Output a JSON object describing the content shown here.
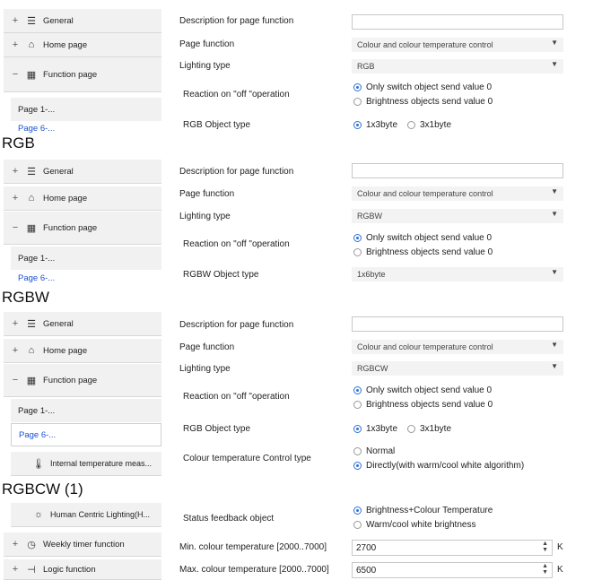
{
  "sidebar_labels": {
    "general": "General",
    "home": "Home page",
    "function": "Function page",
    "page1": "Page 1-...",
    "page6": "Page 6-...",
    "internal_temp": "Internal temperature meas...",
    "hcl": "Human Centric Lighting(H...",
    "weekly": "Weekly timer function",
    "logic": "Logic function"
  },
  "icons": {
    "plus": "+",
    "minus": "−"
  },
  "field_labels": {
    "description": "Description for page function",
    "page_function": "Page function",
    "lighting_type": "Lighting type",
    "reaction": "Reaction on \"off \"operation",
    "rgb_object_type": "RGB Object type",
    "rgbw_object_type": "RGBW Object type",
    "ct_control_type": "Colour temperature Control type",
    "status_feedback": "Status feedback object",
    "min_ct": "Min. colour temperature [2000..7000]",
    "max_ct": "Max. colour temperature [2000..7000]"
  },
  "values": {
    "page_function": "Colour and colour temperature control",
    "rgb": "RGB",
    "rgbw": "RGBW",
    "rgbcw": "RGBCW",
    "rgbw_object_type": "1x6byte",
    "min_ct": "2700",
    "max_ct": "6500",
    "unit": "K"
  },
  "options": {
    "only_switch": "Only switch object send value 0",
    "brightness_objects": "Brightness objects send value 0",
    "x1x3byte": "1x3byte",
    "x3x1byte": "3x1byte",
    "normal": "Normal",
    "directly": "Directly(with warm/cool white algorithm)",
    "brightness_ct": "Brightness+Colour Temperature",
    "warm_cool": "Warm/cool white brightness"
  },
  "captions": {
    "rgb": "RGB",
    "rgbw": "RGBW",
    "rgbcw": "RGBCW (1)"
  }
}
